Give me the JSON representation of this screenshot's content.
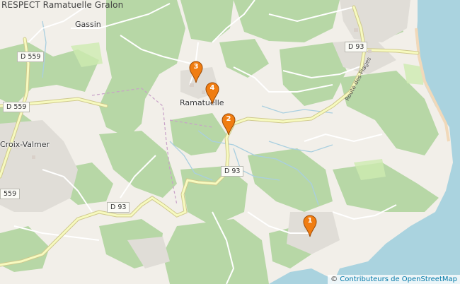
{
  "map": {
    "title": "RESPECT Ramatuelle Gralon",
    "places": {
      "gassin": "Gassin",
      "ramatuelle": "Ramatuelle",
      "croix_valmer": "Croix-Valmer"
    },
    "roads": {
      "d559_top": "D 559",
      "d559_left": "D 559",
      "d559_bottom": "559",
      "d93_top": "D 93",
      "d93_center": "D 93",
      "d93_bottom": "D 93",
      "route_plages": "Route des Plages"
    },
    "markers": [
      {
        "label": "1"
      },
      {
        "label": "2"
      },
      {
        "label": "3"
      },
      {
        "label": "4"
      }
    ],
    "attribution": {
      "symbol": "©",
      "text": "Contributeurs de OpenStreetMap"
    },
    "colors": {
      "sea": "#aad3df",
      "forest": "#add19e",
      "land": "#f2efe9",
      "road_major": "#f7fabf",
      "marker": "#f07d12"
    }
  }
}
